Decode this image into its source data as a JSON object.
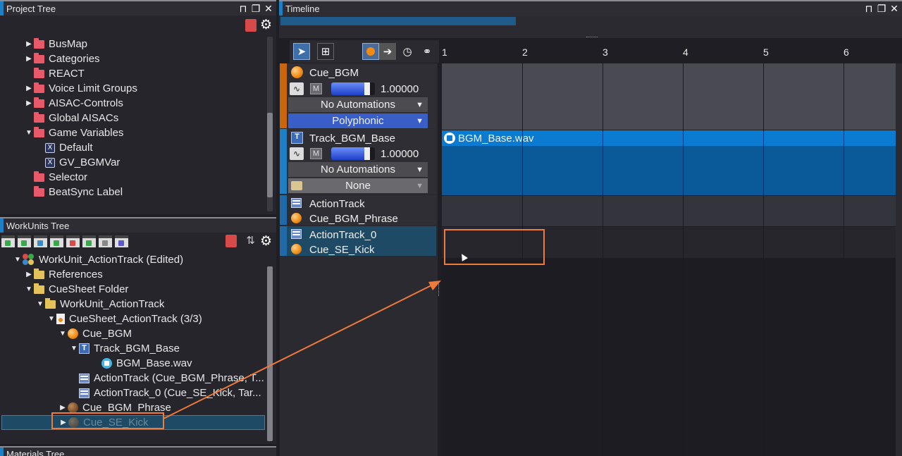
{
  "project_tree": {
    "title": "Project Tree",
    "items": [
      {
        "label": "BusMap",
        "arrow": "▶",
        "icon": "folder-red"
      },
      {
        "label": "Categories",
        "arrow": "▶",
        "icon": "folder-red"
      },
      {
        "label": "REACT",
        "arrow": "",
        "icon": "folder-red"
      },
      {
        "label": "Voice Limit Groups",
        "arrow": "▶",
        "icon": "folder-red"
      },
      {
        "label": "AISAC-Controls",
        "arrow": "▶",
        "icon": "folder-red"
      },
      {
        "label": "Global AISACs",
        "arrow": "",
        "icon": "folder-red"
      },
      {
        "label": "Game Variables",
        "arrow": "▼",
        "icon": "folder-red"
      },
      {
        "label": "Default",
        "arrow": "",
        "icon": "variable-icon"
      },
      {
        "label": "GV_BGMVar",
        "arrow": "",
        "icon": "variable-icon"
      },
      {
        "label": "Selector",
        "arrow": "",
        "icon": "folder-red"
      },
      {
        "label": "BeatSync Label",
        "arrow": "",
        "icon": "folder-red"
      }
    ]
  },
  "workunits_tree": {
    "title": "WorkUnits Tree",
    "items": [
      {
        "label": "WorkUnit_ActionTrack (Edited)",
        "arrow": "▼"
      },
      {
        "label": "References",
        "arrow": "▶"
      },
      {
        "label": "CueSheet Folder",
        "arrow": "▼"
      },
      {
        "label": "WorkUnit_ActionTrack",
        "arrow": "▼"
      },
      {
        "label": "CueSheet_ActionTrack (3/3)",
        "arrow": "▼"
      },
      {
        "label": "Cue_BGM",
        "arrow": "▼"
      },
      {
        "label": "Track_BGM_Base",
        "arrow": "▼"
      },
      {
        "label": "BGM_Base.wav",
        "arrow": ""
      },
      {
        "label": "ActionTrack (Cue_BGM_Phrase, T...",
        "arrow": ""
      },
      {
        "label": "ActionTrack_0 (Cue_SE_Kick, Tar...",
        "arrow": ""
      },
      {
        "label": "Cue_BGM_Phrase",
        "arrow": "▶"
      },
      {
        "label": "Cue_SE_Kick",
        "arrow": "▶"
      }
    ]
  },
  "materials_tree": {
    "title": "Materials Tree"
  },
  "timeline": {
    "title": "Timeline",
    "ruler": [
      "1",
      "2",
      "3",
      "4",
      "5",
      "6"
    ],
    "tracks": {
      "cue_bgm": {
        "name": "Cue_BGM",
        "mute": "M",
        "volume": "1.00000",
        "volume_level": 0.88,
        "automation": "No Automations",
        "mode": "Polyphonic"
      },
      "track_bgm_base": {
        "name": "Track_BGM_Base",
        "mute": "M",
        "volume": "1.00000",
        "volume_level": 0.88,
        "automation": "No Automations",
        "selector": "None",
        "clip": "BGM_Base.wav"
      },
      "action_track": {
        "name": "ActionTrack",
        "target": "Cue_BGM_Phrase"
      },
      "action_track_0": {
        "name": "ActionTrack_0",
        "target": "Cue_SE_Kick"
      }
    },
    "dropdown_arrow": "▼"
  },
  "window_controls": {
    "pin": "⊓",
    "restore": "❐",
    "close": "✕"
  },
  "colors": {
    "accent_blue": "#1f7fc4",
    "highlight_orange": "#f07a3a",
    "clip_blue": "#0a7bd0",
    "selected_row": "#1e4a66"
  }
}
